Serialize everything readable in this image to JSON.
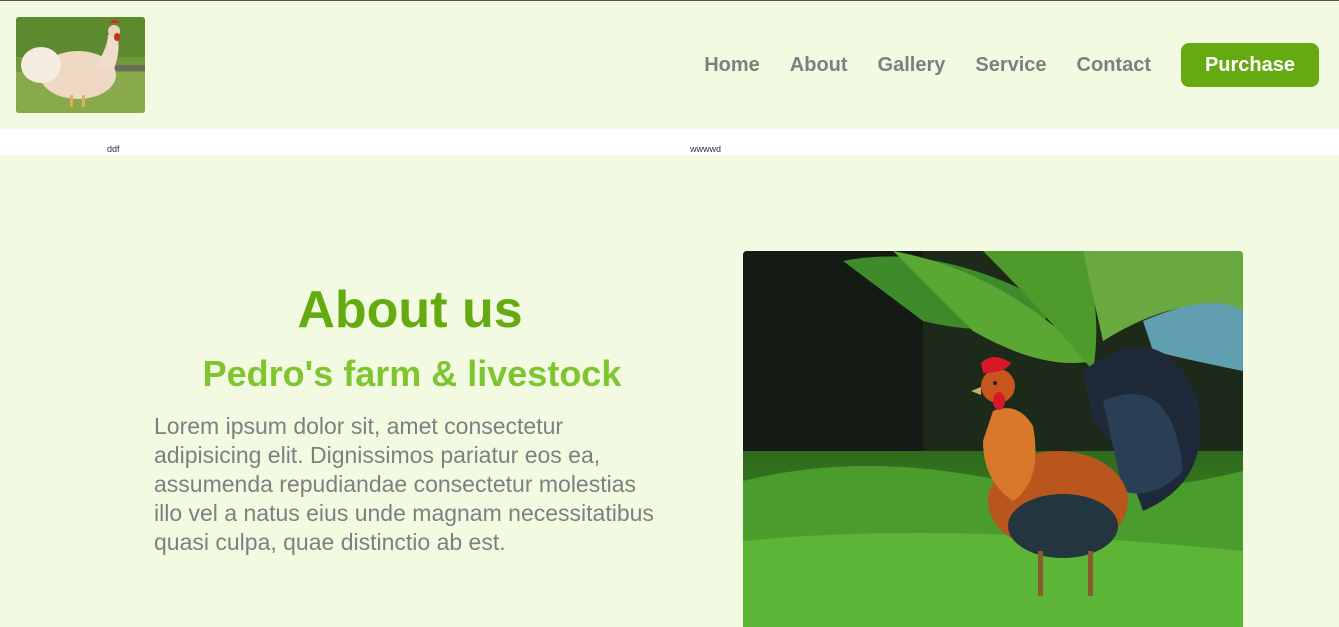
{
  "header": {
    "logo_icon": "hen-photo",
    "nav": [
      "Home",
      "About",
      "Gallery",
      "Service",
      "Contact"
    ],
    "purchase_label": "Purchase"
  },
  "strip": {
    "left_text": "ddf",
    "right_text": "wwwwd"
  },
  "about": {
    "title": "About us",
    "subtitle": "Pedro's farm & livestock",
    "body": "Lorem ipsum dolor sit, amet consectetur adipisicing elit. Dignissimos pariatur eos ea, assumenda repudiandae consectetur molestias illo vel a natus eius unde magnam necessitatibus quasi culpa, quae distinctio ab est.",
    "image_icon": "rooster-photo"
  },
  "colors": {
    "accent": "#66aa11",
    "subtitle": "#7ec530",
    "background": "#f2fbe1",
    "nav_text": "#7f7f7f"
  }
}
